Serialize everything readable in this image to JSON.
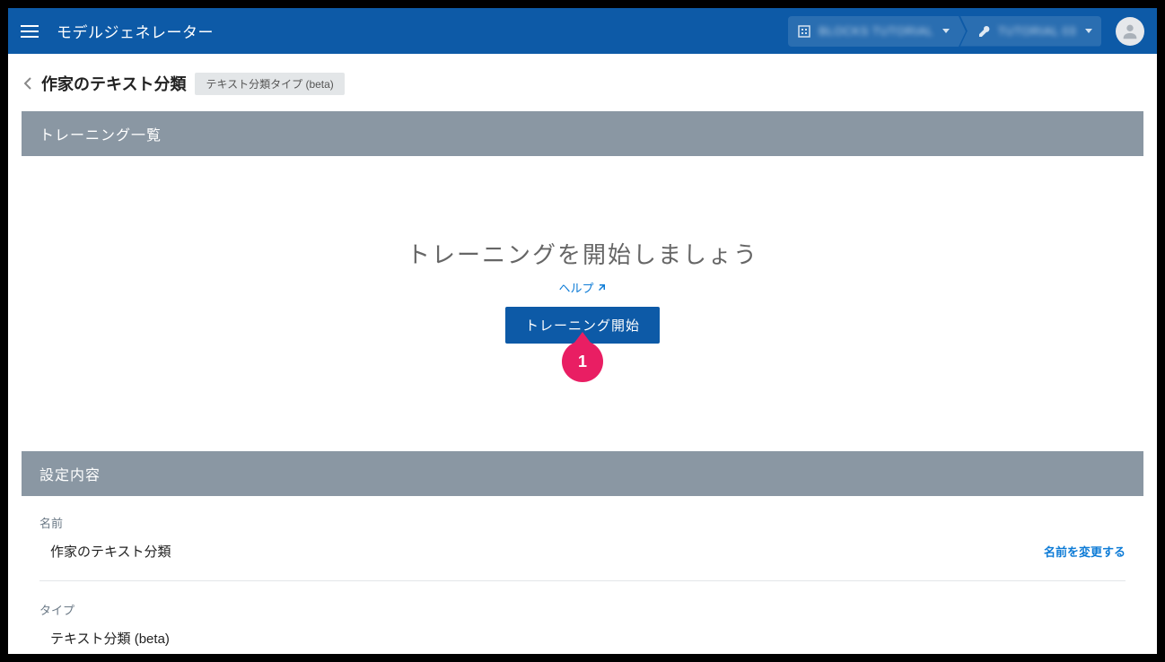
{
  "header": {
    "app_title": "モデルジェネレーター",
    "org_selector": "BLOCKS TUTORIAL",
    "project_selector": "TUTORIAL 03"
  },
  "breadcrumb": {
    "title": "作家のテキスト分類",
    "type_badge": "テキスト分類タイプ (beta)"
  },
  "training": {
    "section_title": "トレーニング一覧",
    "empty_heading": "トレーニングを開始しましょう",
    "help_label": "ヘルプ",
    "start_button": "トレーニング開始",
    "annotation_number": "1"
  },
  "settings": {
    "section_title": "設定内容",
    "fields": {
      "name": {
        "label": "名前",
        "value": "作家のテキスト分類",
        "action": "名前を変更する"
      },
      "type": {
        "label": "タイプ",
        "value": "テキスト分類 (beta)"
      }
    }
  }
}
